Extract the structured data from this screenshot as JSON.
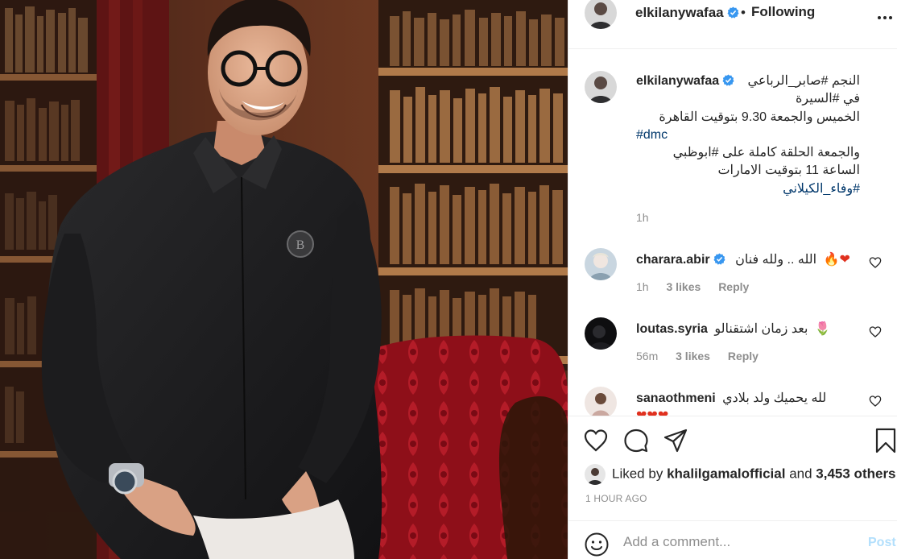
{
  "header": {
    "username": "elkilanywafaa",
    "dot": "•",
    "follow_label": "Following"
  },
  "caption": {
    "username": "elkilanywafaa",
    "lines": [
      "النجم #صابر_الرباعي",
      "في #السيرة",
      "الخميس والجمعة 9.30 بتوقيت القاهرة",
      "#dmc",
      "والجمعة الحلقة كاملة على #ابوظبي",
      "الساعة 11 بتوقيت الامارات",
      "#وفاء_الكيلاني"
    ],
    "time": "1h"
  },
  "comments": [
    {
      "username": "charara.abir",
      "verified": true,
      "text": "الله .. ولله فنان",
      "emoji": "🔥❤",
      "time": "1h",
      "likes": "3 likes",
      "reply": "Reply"
    },
    {
      "username": "loutas.syria",
      "verified": false,
      "text": "بعد زمان اشتقنالو",
      "emoji": "🌷",
      "time": "56m",
      "likes": "3 likes",
      "reply": "Reply"
    },
    {
      "username": "sanaothmeni",
      "verified": false,
      "text": "لله يحميك ولد بلادي",
      "emoji": "❤❤❤",
      "time": "",
      "likes": "",
      "reply": ""
    }
  ],
  "likes": {
    "prefix": "Liked by",
    "user": "khalilgamalofficial",
    "and": "and",
    "others": "3,453 others"
  },
  "timestamp": "1 HOUR AGO",
  "add_comment": {
    "placeholder": "Add a comment...",
    "post_label": "Post"
  },
  "colors": {
    "link": "#00376b",
    "muted": "#8e8e8e",
    "verified": "#3897f0",
    "post_disabled": "#b2dffc"
  },
  "icons": [
    "verified-badge-icon",
    "more-options-icon",
    "heart-icon",
    "comment-icon",
    "share-icon",
    "bookmark-icon",
    "emoji-icon"
  ]
}
